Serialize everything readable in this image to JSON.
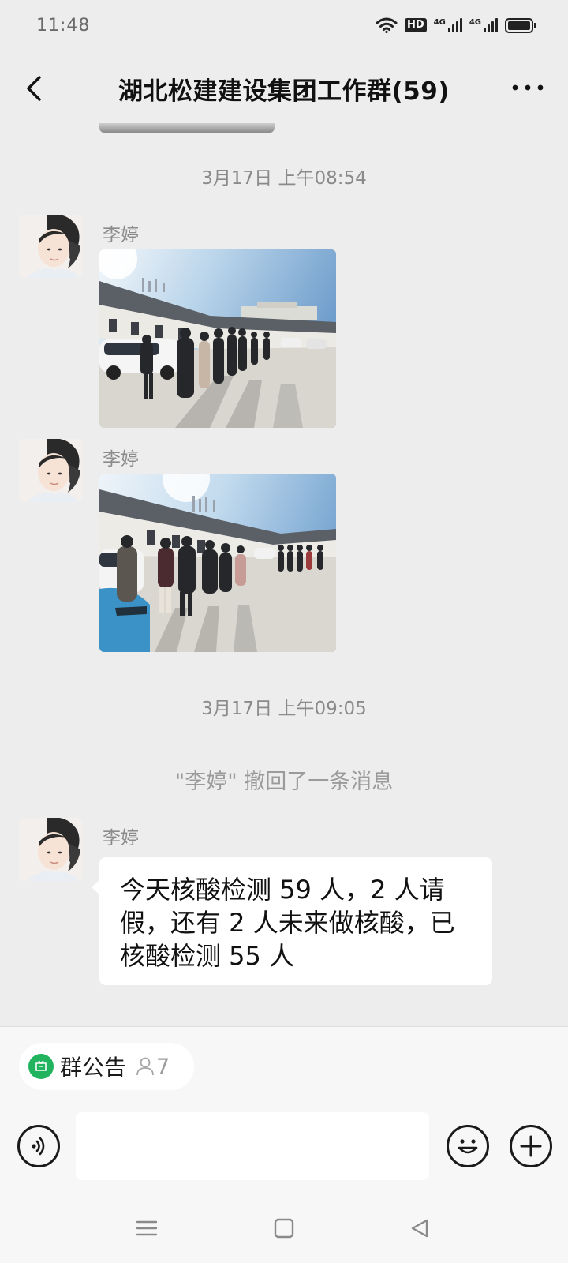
{
  "status_bar": {
    "time": "11:48",
    "hd_label": "HD",
    "network_1": "4G",
    "network_2": "4G",
    "battery_level": 1.0
  },
  "nav": {
    "title": "湖北松建建设集团工作群(59)",
    "back_icon": "chevron-left-icon",
    "more_icon": "ellipsis-icon"
  },
  "messages": [
    {
      "type": "timestamp",
      "text": "3月17日 上午08:54"
    },
    {
      "type": "image",
      "sender": "李婷",
      "alt": "people queuing outside a building"
    },
    {
      "type": "image",
      "sender": "李婷",
      "alt": "people queuing outside a building"
    },
    {
      "type": "timestamp",
      "text": "3月17日 上午09:05"
    },
    {
      "type": "system",
      "text": "\"李婷\" 撤回了一条消息"
    },
    {
      "type": "text",
      "sender": "李婷",
      "text": "今天核酸检测 59 人，2 人请假，还有 2 人未来做核酸，已核酸检测 55 人"
    }
  ],
  "footer": {
    "notice_label": "群公告",
    "notice_count": "7",
    "input_value": "",
    "voice_icon": "voice-icon",
    "emoji_icon": "emoji-icon",
    "plus_icon": "plus-icon"
  },
  "colors": {
    "background": "#ededed",
    "bubble": "#ffffff",
    "notice_green": "#21b35d",
    "timestamp_gray": "#8a8a8a"
  }
}
